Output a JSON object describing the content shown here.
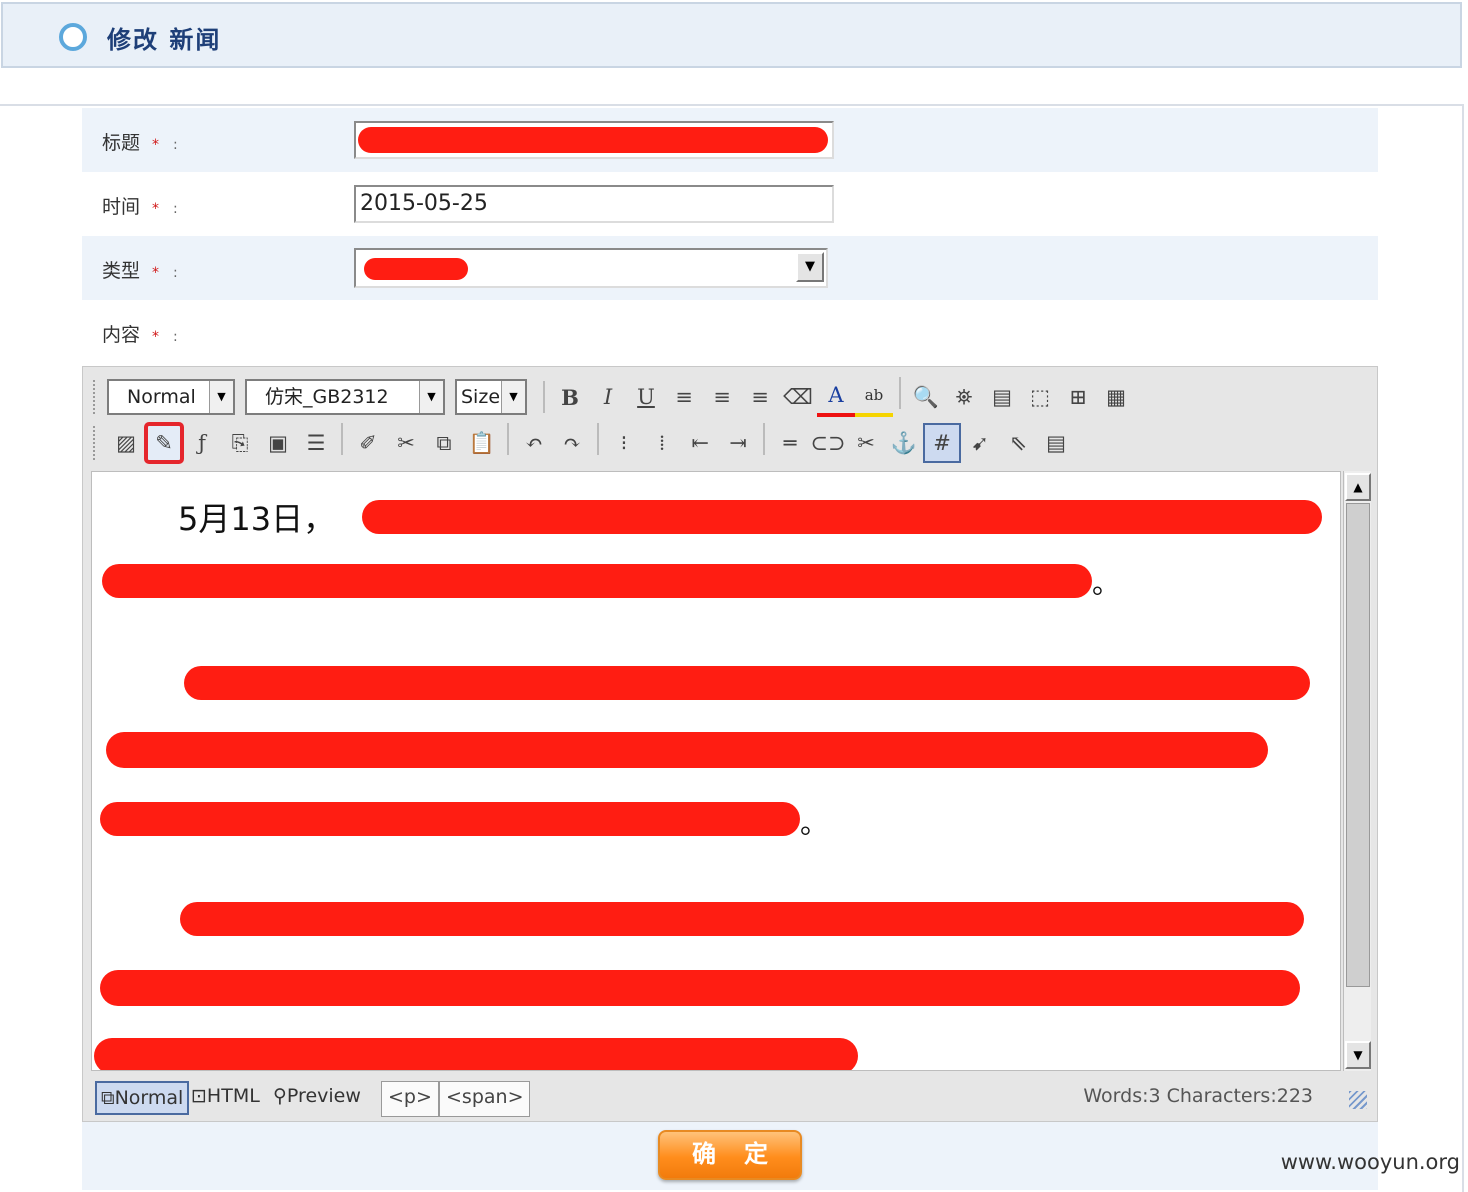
{
  "header": {
    "title": "修改 新闻"
  },
  "form": {
    "title_label": "标题",
    "time_label": "时间",
    "time_value": "2015-05-25",
    "type_label": "类型",
    "content_label": "内容",
    "required_mark": "*",
    "colon": ":"
  },
  "editor": {
    "format_select": "Normal",
    "font_select": "仿宋_GB2312",
    "size_select": "Size",
    "toolbar_row1": [
      {
        "icon": "bold-icon",
        "glyph": "B"
      },
      {
        "icon": "italic-icon",
        "glyph": "I"
      },
      {
        "icon": "underline-icon",
        "glyph": "U"
      },
      {
        "icon": "align-left-icon",
        "glyph": "≡"
      },
      {
        "icon": "align-center-icon",
        "glyph": "≡"
      },
      {
        "icon": "align-right-icon",
        "glyph": "≡"
      },
      {
        "icon": "eraser-icon",
        "glyph": "⌫"
      },
      {
        "icon": "font-color-icon",
        "glyph": "A"
      },
      {
        "icon": "highlight-icon",
        "glyph": "ab"
      },
      {
        "icon": "zoom-icon",
        "glyph": "🔍"
      },
      {
        "icon": "find-icon",
        "glyph": "⛯"
      },
      {
        "icon": "print-preview-icon",
        "glyph": "▤"
      },
      {
        "icon": "layer-icon",
        "glyph": "⬚"
      },
      {
        "icon": "table-cell-icon",
        "glyph": "⊞"
      },
      {
        "icon": "table-icon",
        "glyph": "▦"
      }
    ],
    "toolbar_row2": [
      {
        "icon": "image-icon",
        "glyph": "▨"
      },
      {
        "icon": "insert-media-icon",
        "glyph": "✎"
      },
      {
        "icon": "flash-icon",
        "glyph": "ƒ"
      },
      {
        "icon": "pdf-icon",
        "glyph": "⎘"
      },
      {
        "icon": "word-paste-icon",
        "glyph": "▣"
      },
      {
        "icon": "list-text-icon",
        "glyph": "☰"
      },
      {
        "icon": "clean-icon",
        "glyph": "✐"
      },
      {
        "icon": "cut-icon",
        "glyph": "✂"
      },
      {
        "icon": "copy-icon",
        "glyph": "⧉"
      },
      {
        "icon": "paste-icon",
        "glyph": "📋"
      },
      {
        "icon": "undo-icon",
        "glyph": "↶"
      },
      {
        "icon": "redo-icon",
        "glyph": "↷"
      },
      {
        "icon": "ordered-list-icon",
        "glyph": "⁝"
      },
      {
        "icon": "unordered-list-icon",
        "glyph": "⁞"
      },
      {
        "icon": "outdent-icon",
        "glyph": "⇤"
      },
      {
        "icon": "indent-icon",
        "glyph": "⇥"
      },
      {
        "icon": "horizontal-rule-icon",
        "glyph": "═"
      },
      {
        "icon": "link-icon",
        "glyph": "⊂⊃"
      },
      {
        "icon": "unlink-icon",
        "glyph": "✂"
      },
      {
        "icon": "anchor-icon",
        "glyph": "⚓"
      },
      {
        "icon": "grid-icon",
        "glyph": "#"
      },
      {
        "icon": "absolute-position-icon",
        "glyph": "➹"
      },
      {
        "icon": "select-pointer-icon",
        "glyph": "⇖"
      },
      {
        "icon": "form-icon",
        "glyph": "▤"
      }
    ],
    "content_text": "5月13日，",
    "period": "。",
    "modes": {
      "normal": "Normal",
      "html": "HTML",
      "preview": "Preview"
    },
    "tags": [
      "<p>",
      "<span>"
    ],
    "word_count": "Words:3 Characters:223"
  },
  "submit_label": "确定",
  "watermark": "www.wooyun.org",
  "colors": {
    "header_bg": "#e9f0f8",
    "row_shade": "#edf3fa",
    "required": "#d01717",
    "submit": "#ff8d1c",
    "redaction": "#ff1d12"
  }
}
